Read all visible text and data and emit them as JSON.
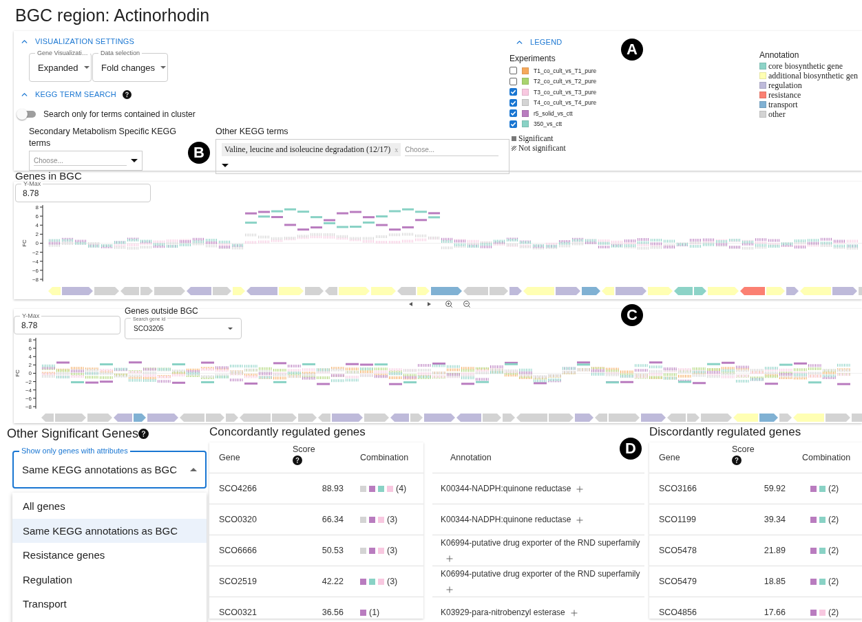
{
  "title": "BGC region: Actinorhodin",
  "settings": {
    "visualization": {
      "header": "VISUALIZATION SETTINGS",
      "expanded": true,
      "selects": [
        {
          "label": "Gene Visualizati…",
          "value": "Expanded"
        },
        {
          "label": "Data selection",
          "value": "Fold changes"
        }
      ]
    },
    "kegg": {
      "header": "KEGG TERM SEARCH",
      "expanded": true,
      "marker": "B",
      "switch": {
        "label": "Search only for terms contained in cluster",
        "on": false
      },
      "secondary": {
        "label": "Secondary Metabolism Specific KEGG terms",
        "placeholder": "Choose..."
      },
      "other": {
        "label": "Other KEGG terms",
        "chips": [
          {
            "label": "Valine, leucine and isoleucine degradation (12/17)",
            "remove": "x"
          }
        ],
        "placeholder": "Choose..."
      }
    },
    "legend": {
      "header": "LEGEND",
      "expanded": true,
      "marker": "A",
      "experiments_title": "Experiments",
      "experiments": [
        {
          "name": "T1_co_cult_vs_T1_pure",
          "color": "#f5a95c",
          "checked": false
        },
        {
          "name": "T2_co_cult_vs_T2_pure",
          "color": "#a9d46f",
          "checked": false
        },
        {
          "name": "T3_co_cult_vs_T3_pure",
          "color": "#f8c8e0",
          "checked": true
        },
        {
          "name": "T4_co_cult_vs_T4_pure",
          "color": "#d4d4d4",
          "checked": true
        },
        {
          "name": "r5_solid_vs_ctt",
          "color": "#b97cbf",
          "checked": true
        },
        {
          "name": "350_vs_ctt",
          "color": "#89d2c5",
          "checked": true
        }
      ],
      "significance": [
        {
          "label": "Significant",
          "kind": "solid"
        },
        {
          "label": "Not significant",
          "kind": "hatched"
        }
      ],
      "annotation_title": "Annotation",
      "annotations": [
        {
          "label": "core biosynthetic gene",
          "color": "#8dd3c7"
        },
        {
          "label": "additional biosynthetic gen",
          "color": "#ffffb3"
        },
        {
          "label": "regulation",
          "color": "#bebada"
        },
        {
          "label": "resistance",
          "color": "#fb8072"
        },
        {
          "label": "transport",
          "color": "#80b1d3"
        },
        {
          "label": "other",
          "color": "#d3d3d3"
        }
      ]
    }
  },
  "genes_in_bgc": {
    "title": "Genes in BGC",
    "ymax_label": "Y-Max",
    "ymax": "8.78",
    "ylabel": "FC",
    "yticks": [
      "8",
      "6",
      "4",
      "2",
      "0",
      "−2",
      "−4",
      "−6",
      "−8"
    ]
  },
  "genes_outside_bgc": {
    "title": "Genes outside BGC",
    "marker": "C",
    "ymax_label": "Y-Max",
    "ymax": "8.78",
    "search": {
      "label": "Search gene id",
      "value": "SCO3205"
    },
    "ylabel": "FC",
    "yticks": [
      "8",
      "6",
      "4",
      "2",
      "0",
      "−2",
      "−4",
      "−6",
      "−8"
    ]
  },
  "other_genes": {
    "title": "Other Significant Genes",
    "filter": {
      "label": "Show only genes with attributes",
      "value": "Same KEGG annotations as BGC",
      "open": true
    },
    "options": [
      {
        "label": "All genes",
        "selected": false
      },
      {
        "label": "Same KEGG annotations as BGC",
        "selected": true
      },
      {
        "label": "Resistance genes",
        "selected": false
      },
      {
        "label": "Regulation",
        "selected": false
      },
      {
        "label": "Transport",
        "selected": false
      }
    ]
  },
  "concordant": {
    "title": "Concordantly regulated genes",
    "marker": "D",
    "columns": [
      "Gene",
      "Score",
      "Combination",
      "Annotation"
    ],
    "rows": [
      {
        "gene": "SCO4266",
        "score": "88.93",
        "combination": [
          {
            "color": "#d4d4d4"
          },
          {
            "color": "#b97cbf"
          },
          {
            "color": "#89d2c5"
          },
          {
            "color": "#f8c8e0"
          }
        ],
        "count": "(4)",
        "annotation": "K00344-NADPH:quinone reductase"
      },
      {
        "gene": "SCO0320",
        "score": "66.34",
        "combination": [
          {
            "color": "#d4d4d4"
          },
          {
            "color": "#b97cbf"
          },
          {
            "color": "#f8c8e0"
          }
        ],
        "count": "(3)",
        "annotation": "K00344-NADPH:quinone reductase"
      },
      {
        "gene": "SCO6666",
        "score": "50.53",
        "combination": [
          {
            "color": "#d4d4d4"
          },
          {
            "color": "#b97cbf"
          },
          {
            "color": "#f8c8e0"
          }
        ],
        "count": "(3)",
        "annotation": "K06994-putative drug exporter of the RND superfamily"
      },
      {
        "gene": "SCO2519",
        "score": "42.22",
        "combination": [
          {
            "color": "#b97cbf"
          },
          {
            "color": "#89d2c5"
          },
          {
            "color": "#f8c8e0"
          }
        ],
        "count": "(3)",
        "annotation": "K06994-putative drug exporter of the RND superfamily"
      },
      {
        "gene": "SCO0321",
        "score": "36.56",
        "combination": [
          {
            "color": "#b97cbf"
          }
        ],
        "count": "(1)",
        "annotation": "K03929-para-nitrobenzyl esterase"
      }
    ]
  },
  "discordant": {
    "title": "Discordantly regulated genes",
    "columns": [
      "Gene",
      "Score",
      "Combination"
    ],
    "rows": [
      {
        "gene": "SCO3166",
        "score": "59.92",
        "combination": [
          {
            "color": "#b97cbf"
          },
          {
            "color": "#89d2c5"
          }
        ],
        "count": "(2)"
      },
      {
        "gene": "SCO1199",
        "score": "39.34",
        "combination": [
          {
            "color": "#b97cbf"
          },
          {
            "color": "#89d2c5"
          }
        ],
        "count": "(2)"
      },
      {
        "gene": "SCO5478",
        "score": "21.89",
        "combination": [
          {
            "color": "#b97cbf"
          },
          {
            "color": "#89d2c5"
          }
        ],
        "count": "(2)"
      },
      {
        "gene": "SCO5479",
        "score": "18.85",
        "combination": [
          {
            "color": "#b97cbf"
          },
          {
            "color": "#89d2c5"
          }
        ],
        "count": "(2)"
      },
      {
        "gene": "SCO4856",
        "score": "17.66",
        "combination": [
          {
            "color": "#b97cbf"
          },
          {
            "color": "#f8c8e0"
          }
        ],
        "count": "(2)"
      }
    ]
  }
}
